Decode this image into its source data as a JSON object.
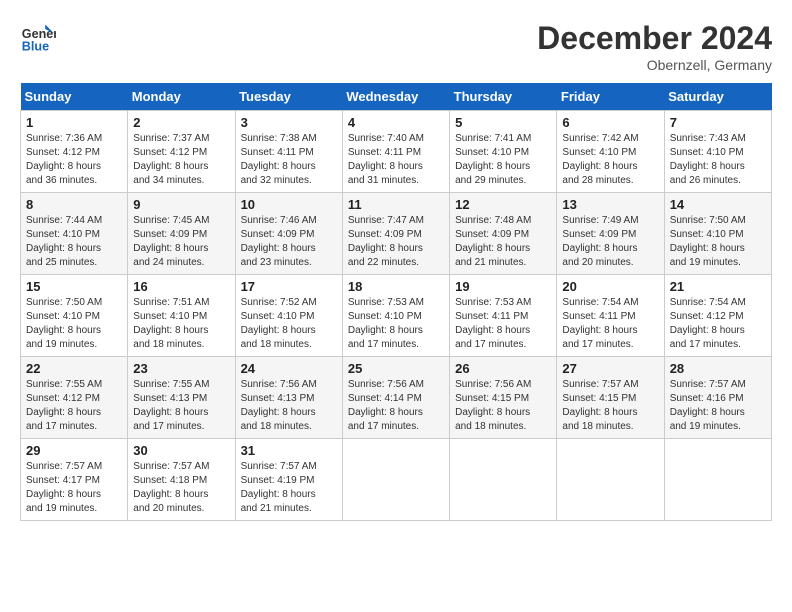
{
  "logo": {
    "line1": "General",
    "line2": "Blue"
  },
  "title": "December 2024",
  "subtitle": "Obernzell, Germany",
  "days_header": [
    "Sunday",
    "Monday",
    "Tuesday",
    "Wednesday",
    "Thursday",
    "Friday",
    "Saturday"
  ],
  "weeks": [
    [
      {
        "day": "1",
        "info": "Sunrise: 7:36 AM\nSunset: 4:12 PM\nDaylight: 8 hours\nand 36 minutes."
      },
      {
        "day": "2",
        "info": "Sunrise: 7:37 AM\nSunset: 4:12 PM\nDaylight: 8 hours\nand 34 minutes."
      },
      {
        "day": "3",
        "info": "Sunrise: 7:38 AM\nSunset: 4:11 PM\nDaylight: 8 hours\nand 32 minutes."
      },
      {
        "day": "4",
        "info": "Sunrise: 7:40 AM\nSunset: 4:11 PM\nDaylight: 8 hours\nand 31 minutes."
      },
      {
        "day": "5",
        "info": "Sunrise: 7:41 AM\nSunset: 4:10 PM\nDaylight: 8 hours\nand 29 minutes."
      },
      {
        "day": "6",
        "info": "Sunrise: 7:42 AM\nSunset: 4:10 PM\nDaylight: 8 hours\nand 28 minutes."
      },
      {
        "day": "7",
        "info": "Sunrise: 7:43 AM\nSunset: 4:10 PM\nDaylight: 8 hours\nand 26 minutes."
      }
    ],
    [
      {
        "day": "8",
        "info": "Sunrise: 7:44 AM\nSunset: 4:10 PM\nDaylight: 8 hours\nand 25 minutes."
      },
      {
        "day": "9",
        "info": "Sunrise: 7:45 AM\nSunset: 4:09 PM\nDaylight: 8 hours\nand 24 minutes."
      },
      {
        "day": "10",
        "info": "Sunrise: 7:46 AM\nSunset: 4:09 PM\nDaylight: 8 hours\nand 23 minutes."
      },
      {
        "day": "11",
        "info": "Sunrise: 7:47 AM\nSunset: 4:09 PM\nDaylight: 8 hours\nand 22 minutes."
      },
      {
        "day": "12",
        "info": "Sunrise: 7:48 AM\nSunset: 4:09 PM\nDaylight: 8 hours\nand 21 minutes."
      },
      {
        "day": "13",
        "info": "Sunrise: 7:49 AM\nSunset: 4:09 PM\nDaylight: 8 hours\nand 20 minutes."
      },
      {
        "day": "14",
        "info": "Sunrise: 7:50 AM\nSunset: 4:10 PM\nDaylight: 8 hours\nand 19 minutes."
      }
    ],
    [
      {
        "day": "15",
        "info": "Sunrise: 7:50 AM\nSunset: 4:10 PM\nDaylight: 8 hours\nand 19 minutes."
      },
      {
        "day": "16",
        "info": "Sunrise: 7:51 AM\nSunset: 4:10 PM\nDaylight: 8 hours\nand 18 minutes."
      },
      {
        "day": "17",
        "info": "Sunrise: 7:52 AM\nSunset: 4:10 PM\nDaylight: 8 hours\nand 18 minutes."
      },
      {
        "day": "18",
        "info": "Sunrise: 7:53 AM\nSunset: 4:10 PM\nDaylight: 8 hours\nand 17 minutes."
      },
      {
        "day": "19",
        "info": "Sunrise: 7:53 AM\nSunset: 4:11 PM\nDaylight: 8 hours\nand 17 minutes."
      },
      {
        "day": "20",
        "info": "Sunrise: 7:54 AM\nSunset: 4:11 PM\nDaylight: 8 hours\nand 17 minutes."
      },
      {
        "day": "21",
        "info": "Sunrise: 7:54 AM\nSunset: 4:12 PM\nDaylight: 8 hours\nand 17 minutes."
      }
    ],
    [
      {
        "day": "22",
        "info": "Sunrise: 7:55 AM\nSunset: 4:12 PM\nDaylight: 8 hours\nand 17 minutes."
      },
      {
        "day": "23",
        "info": "Sunrise: 7:55 AM\nSunset: 4:13 PM\nDaylight: 8 hours\nand 17 minutes."
      },
      {
        "day": "24",
        "info": "Sunrise: 7:56 AM\nSunset: 4:13 PM\nDaylight: 8 hours\nand 18 minutes."
      },
      {
        "day": "25",
        "info": "Sunrise: 7:56 AM\nSunset: 4:14 PM\nDaylight: 8 hours\nand 17 minutes."
      },
      {
        "day": "26",
        "info": "Sunrise: 7:56 AM\nSunset: 4:15 PM\nDaylight: 8 hours\nand 18 minutes."
      },
      {
        "day": "27",
        "info": "Sunrise: 7:57 AM\nSunset: 4:15 PM\nDaylight: 8 hours\nand 18 minutes."
      },
      {
        "day": "28",
        "info": "Sunrise: 7:57 AM\nSunset: 4:16 PM\nDaylight: 8 hours\nand 19 minutes."
      }
    ],
    [
      {
        "day": "29",
        "info": "Sunrise: 7:57 AM\nSunset: 4:17 PM\nDaylight: 8 hours\nand 19 minutes."
      },
      {
        "day": "30",
        "info": "Sunrise: 7:57 AM\nSunset: 4:18 PM\nDaylight: 8 hours\nand 20 minutes."
      },
      {
        "day": "31",
        "info": "Sunrise: 7:57 AM\nSunset: 4:19 PM\nDaylight: 8 hours\nand 21 minutes."
      },
      {
        "day": "",
        "info": ""
      },
      {
        "day": "",
        "info": ""
      },
      {
        "day": "",
        "info": ""
      },
      {
        "day": "",
        "info": ""
      }
    ]
  ]
}
